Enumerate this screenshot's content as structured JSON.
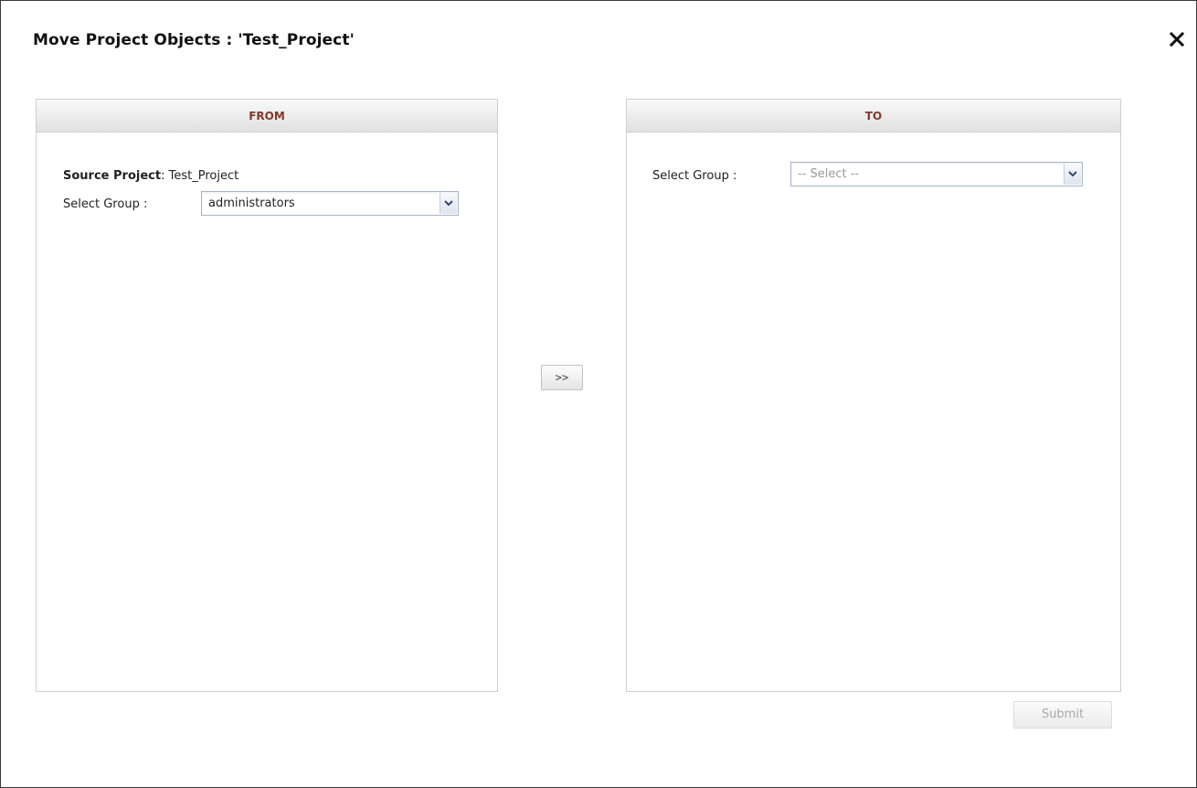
{
  "dialog": {
    "title": "Move Project Objects : 'Test_Project'",
    "close_icon": "close-icon"
  },
  "from_panel": {
    "header": "FROM",
    "source_project_label": "Source Project",
    "source_project_separator": ":",
    "source_project_value": "Test_Project",
    "select_group_label": "Select Group :",
    "select_group_value": "administrators",
    "dropdown_icon": "chevron-down-icon"
  },
  "move_button": {
    "label": ">>"
  },
  "to_panel": {
    "header": "TO",
    "select_group_label": "Select Group :",
    "select_group_placeholder": "-- Select --",
    "dropdown_icon": "chevron-down-icon"
  },
  "footer": {
    "submit_label": "Submit",
    "submit_enabled": false
  },
  "colors": {
    "header_text": "#7d3a2c",
    "border": "#cfcfcf"
  }
}
